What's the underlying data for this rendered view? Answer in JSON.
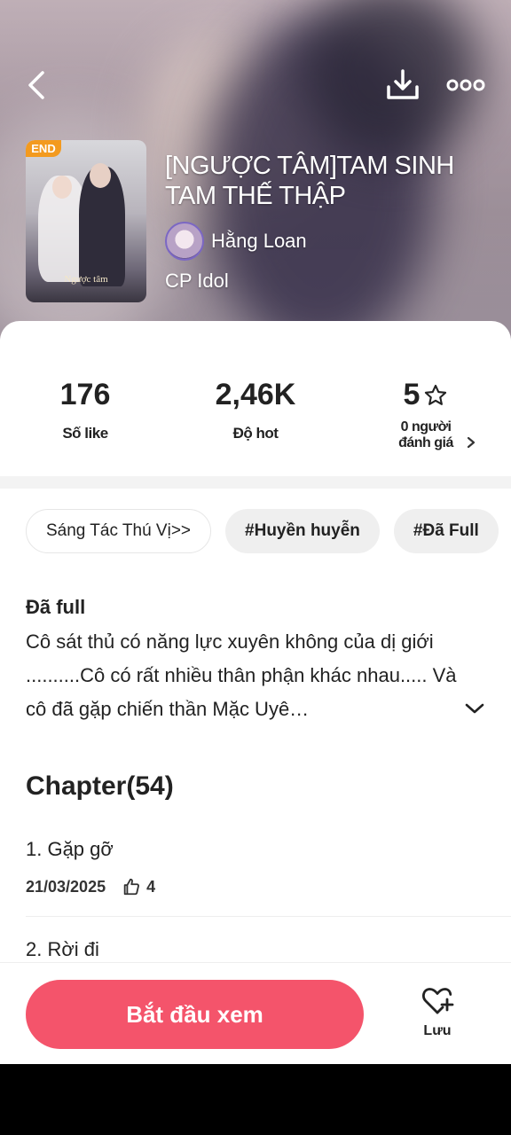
{
  "story": {
    "title": "[NGƯỢC TÂM]TAM SINH TAM THẾ THẬP",
    "author": "Hằng Loan",
    "category": "CP Idol",
    "cover_badge": "END",
    "cover_title": "Ngược tâm"
  },
  "stats": {
    "likes": {
      "value": "176",
      "label": "Số like"
    },
    "hot": {
      "value": "2,46K",
      "label": "Độ hot"
    },
    "rating": {
      "value": "5",
      "label": "0 người đánh giá"
    }
  },
  "tags": [
    "Sáng Tác Thú Vị>>",
    "#Huyền huyễn",
    "#Đã Full"
  ],
  "description": {
    "status": "Đã full",
    "text": "Cô sát thủ có năng lực xuyên không của dị giới ..........Cô có rất nhiều thân phận khác nhau..... Và cô đã gặp chiến thần Mặc Uyê…"
  },
  "chapters": {
    "heading": "Chapter(54)",
    "items": [
      {
        "title": "1. Gặp gỡ",
        "date": "21/03/2025",
        "likes": "4"
      },
      {
        "title": "2. Rời đi"
      }
    ]
  },
  "actions": {
    "start_label": "Bắt đầu xem",
    "save_label": "Lưu"
  },
  "colors": {
    "accent": "#f4546b",
    "badge": "#f39a1f"
  }
}
